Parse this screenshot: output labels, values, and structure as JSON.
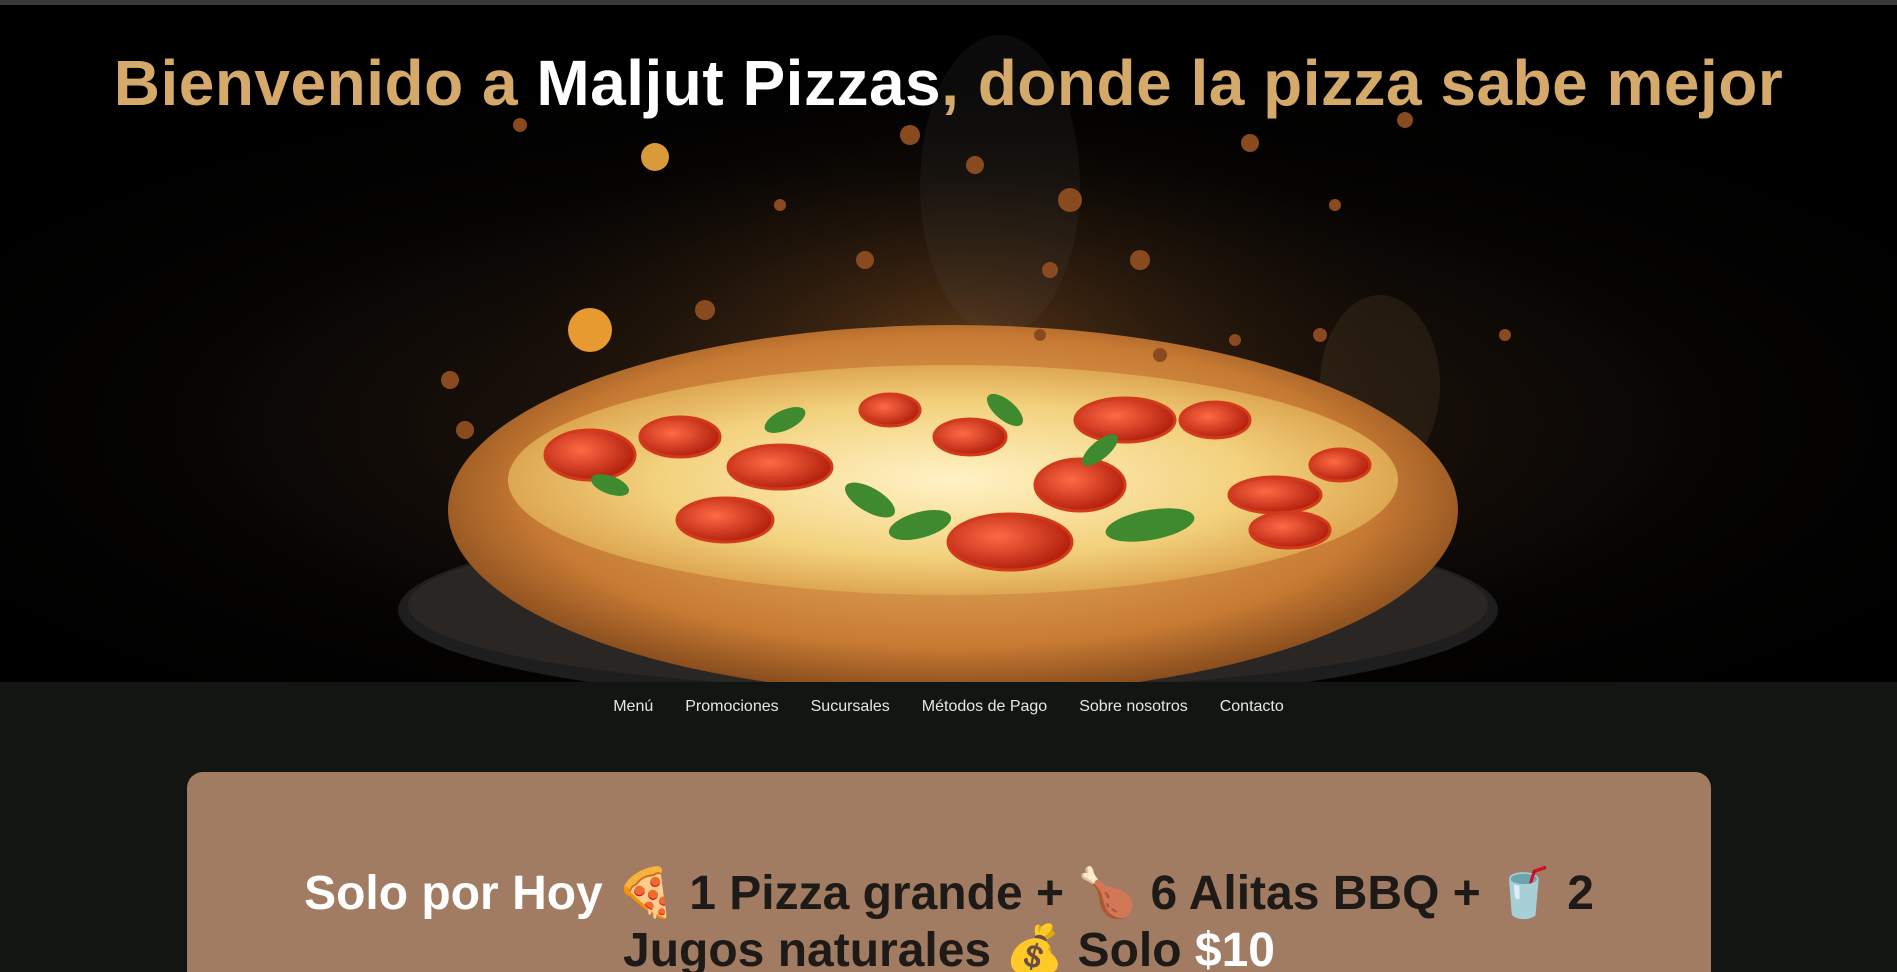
{
  "hero": {
    "title_before": "Bienvenido a ",
    "title_brand": "Maljut Pizzas",
    "title_after": ", donde la pizza sabe mejor",
    "image": "pizza-hero-image"
  },
  "nav": {
    "items": [
      {
        "label": "Menú"
      },
      {
        "label": "Promociones"
      },
      {
        "label": "Sucursales"
      },
      {
        "label": "Métodos de Pago"
      },
      {
        "label": "Sobre nosotros"
      },
      {
        "label": "Contacto"
      }
    ]
  },
  "promo": {
    "lead": "Solo por Hoy",
    "pizza_emoji": "🍕",
    "part1": " 1 Pizza grande + ",
    "wing_emoji": "🍗",
    "part2": " 6 Alitas BBQ + ",
    "drink_emoji": "🥤",
    "part3": " 2 Jugos naturales ",
    "money_emoji": "💰",
    "part4": " Solo ",
    "price": "$10"
  },
  "colors": {
    "accent_gold": "#d4a96a",
    "brand_white": "#ffffff",
    "nav_bg": "#131513",
    "promo_bg": "#a27c62",
    "promo_text": "#1e1a17"
  }
}
